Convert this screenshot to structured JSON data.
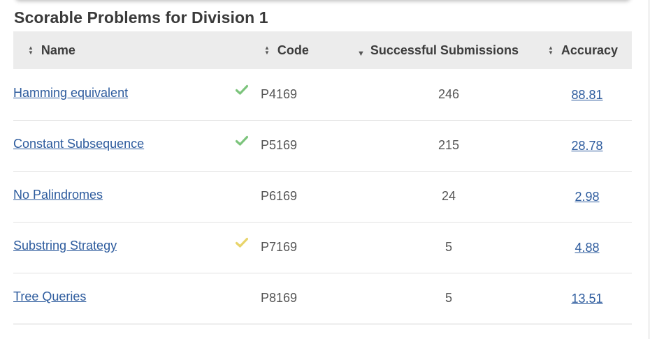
{
  "page": {
    "title": "Scorable Problems for Division 1"
  },
  "table": {
    "columns": {
      "name": "Name",
      "code": "Code",
      "successful_submissions": "Successful Submissions",
      "accuracy": "Accuracy"
    },
    "sort": {
      "active_column": "successful_submissions",
      "direction": "descending"
    },
    "rows": [
      {
        "name": "Hamming equivalent",
        "status": "solved",
        "code": "P4169",
        "submissions": "246",
        "accuracy": "88.81"
      },
      {
        "name": "Constant Subsequence",
        "status": "solved",
        "code": "P5169",
        "submissions": "215",
        "accuracy": "28.78"
      },
      {
        "name": "No Palindromes",
        "status": "none",
        "code": "P6169",
        "submissions": "24",
        "accuracy": "2.98"
      },
      {
        "name": "Substring Strategy",
        "status": "partial",
        "code": "P7169",
        "submissions": "5",
        "accuracy": "4.88"
      },
      {
        "name": "Tree Queries",
        "status": "none",
        "code": "P8169",
        "submissions": "5",
        "accuracy": "13.51"
      }
    ]
  },
  "colors": {
    "link": "#2e5c9e",
    "header_bg": "#ececec",
    "check_solved": "#7cc47c",
    "check_partial": "#e8d46a"
  }
}
